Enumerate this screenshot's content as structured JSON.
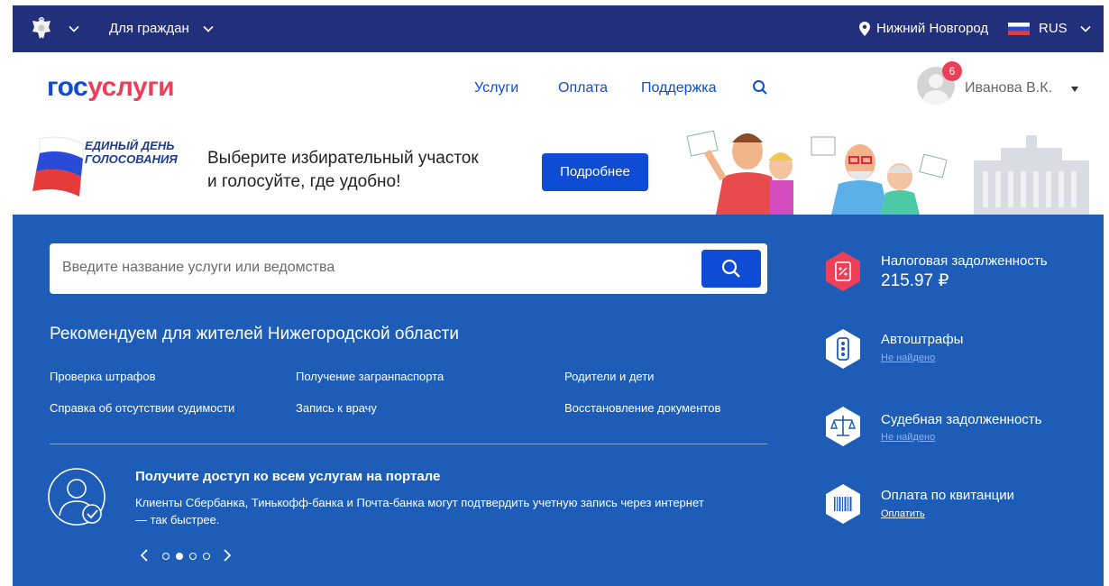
{
  "topbar": {
    "emblem_icon": "coat-of-arms-icon",
    "audience_label": "Для граждан",
    "location_icon": "map-pin-icon",
    "city": "Нижний Новгород",
    "language": "RUS"
  },
  "header": {
    "logo": {
      "part1": "гос",
      "part2": "услуги"
    },
    "nav": [
      "Услуги",
      "Оплата",
      "Поддержка"
    ],
    "search_icon": "search-icon",
    "notification_count": "6",
    "user_name": "Иванова В.К."
  },
  "banner": {
    "badge_line1": "ЕДИНЫЙ ДЕНЬ",
    "badge_line2": "ГОЛОСОВАНИЯ",
    "text_line1": "Выберите избирательный участок",
    "text_line2": "и голосуйте, где удобно!",
    "button": "Подробнее"
  },
  "search": {
    "placeholder": "Введите название услуги или ведомства"
  },
  "recommend": {
    "title": "Рекомендуем для жителей Нижегородской области",
    "links": [
      "Проверка штрафов",
      "Получение загранпаспорта",
      "Родители и дети",
      "Справка об отсутствии судимости",
      "Запись к врачу",
      "Восстановление документов"
    ]
  },
  "access": {
    "title": "Получите доступ ко всем услугам на портале",
    "description": "Клиенты Сбербанка, Тинькофф-банка и Почта-банка могут подтвердить учетную запись через интернет — так быстрее.",
    "carousel_active_index": 1,
    "carousel_count": 4
  },
  "widgets": {
    "tax": {
      "title": "Налоговая задолженность",
      "amount": "215.97 ₽",
      "icon": "tax-document-icon"
    },
    "fines": {
      "title": "Автоштрафы",
      "status": "Не найдено",
      "icon": "traffic-light-icon"
    },
    "court": {
      "title": "Судебная задолженность",
      "status": "Не найдено",
      "icon": "scales-icon"
    },
    "receipt": {
      "title": "Оплата по квитанции",
      "action": "Оплатить",
      "icon": "barcode-icon"
    }
  },
  "colors": {
    "topbar": "#222f7b",
    "main": "#1d5db7",
    "accent_blue": "#0d4cd3",
    "accent_red": "#ee3f58"
  }
}
